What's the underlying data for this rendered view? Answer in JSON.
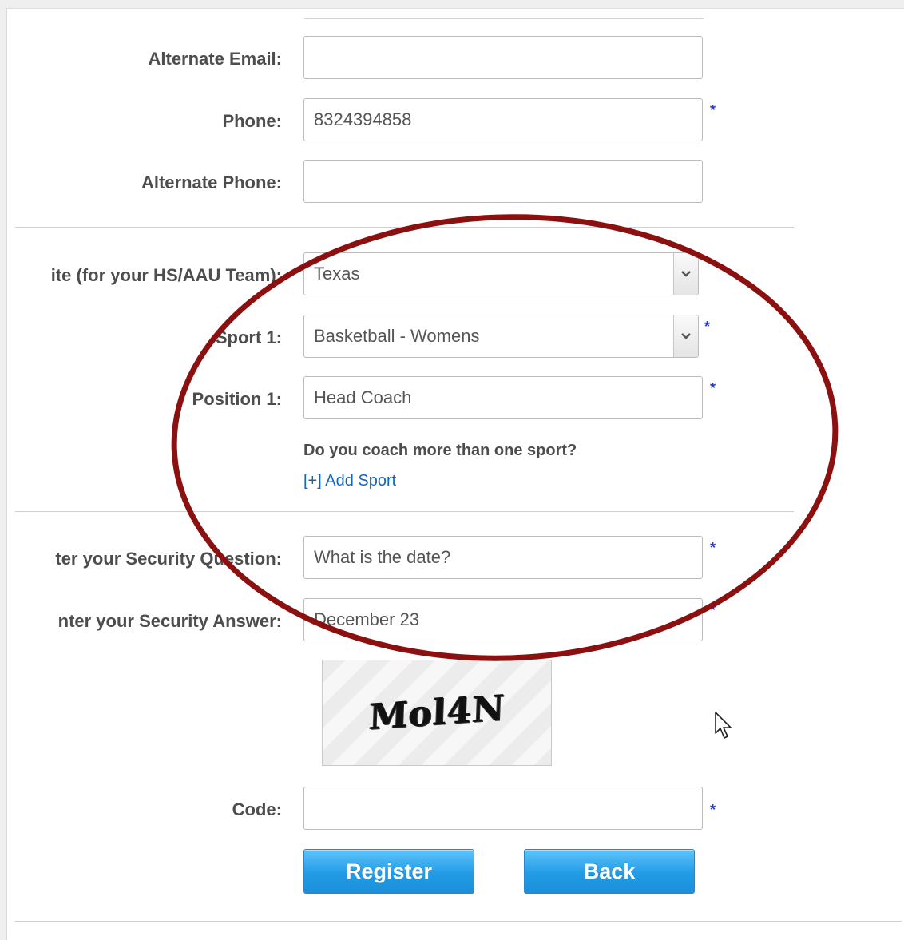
{
  "form": {
    "alternate_email": {
      "label": "Alternate Email:",
      "value": ""
    },
    "phone": {
      "label": "Phone:",
      "value": "8324394858"
    },
    "alternate_phone": {
      "label": "Alternate Phone:",
      "value": ""
    },
    "state": {
      "label": "ite (for your HS/AAU Team):",
      "value": "Texas"
    },
    "sport1": {
      "label": "Sport 1:",
      "value": "Basketball - Womens"
    },
    "position1": {
      "label": "Position 1:",
      "value": "Head Coach"
    },
    "multi_sport_question": "Do you coach more than one sport?",
    "add_sport_link": "[+] Add Sport",
    "security_question": {
      "label": "ter your Security Question:",
      "value": "What is the date?"
    },
    "security_answer": {
      "label": "nter your Security Answer:",
      "value": "December 23"
    },
    "captcha_text": "Mol4N",
    "code": {
      "label": "Code:",
      "value": ""
    },
    "required_mark": "*"
  },
  "buttons": {
    "register": "Register",
    "back": "Back"
  },
  "colors": {
    "button_blue": "#229be6",
    "required_blue": "#2a35c9",
    "link_blue": "#1565c0",
    "annotation_red": "#8b1010"
  }
}
